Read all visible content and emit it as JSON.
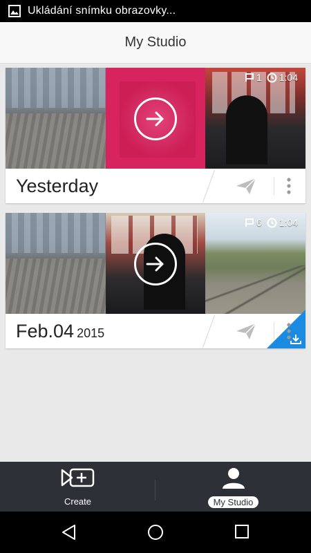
{
  "status_bar": {
    "text": "Ukládání snímku obrazovky...",
    "icon": "image-icon"
  },
  "header": {
    "title": "My Studio"
  },
  "projects": [
    {
      "title": "Yesterday",
      "year": "",
      "clip_count": "1",
      "duration": "1:04",
      "downloadable": false
    },
    {
      "title": "Feb.04",
      "year": "2015",
      "clip_count": "6",
      "duration": "1:04",
      "downloadable": true
    }
  ],
  "bottom_nav": {
    "items": [
      {
        "label": "Create",
        "icon": "create-video-icon",
        "active": false
      },
      {
        "label": "My Studio",
        "icon": "person-icon",
        "active": true
      }
    ]
  },
  "system_nav": {
    "buttons": [
      "back-icon",
      "home-icon",
      "recent-apps-icon"
    ]
  },
  "colors": {
    "accent_pink": "#d8245e",
    "download_blue": "#1a8be0",
    "nav_bg": "#2d3036"
  }
}
